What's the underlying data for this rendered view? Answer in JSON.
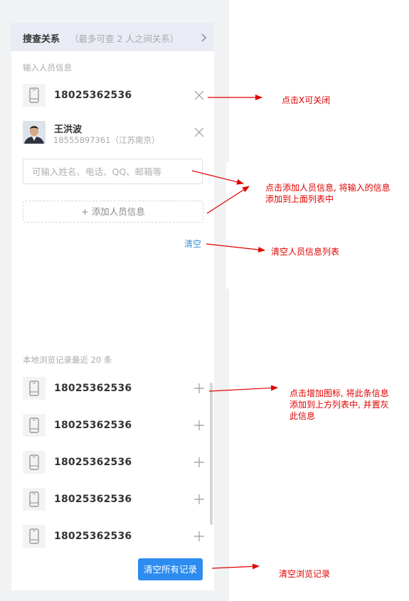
{
  "header": {
    "title": "搜查关系",
    "subtitle": "（最多可查 2 人之间关系）",
    "icon": "chevron-right-icon"
  },
  "input_section": {
    "label": "输入人员信息",
    "phone_entry": {
      "number": "18025362536",
      "icon": "mobile-phone-icon",
      "action_icon": "close-icon"
    },
    "person_entry": {
      "name": "王洪波",
      "detail": "18555897361（江苏南京）",
      "action_icon": "close-icon"
    },
    "search_input": {
      "value": "",
      "placeholder": "可输入姓名、电话、QQ、邮箱等"
    },
    "add_button_label": "+ 添加人员信息",
    "clear_label": "清空"
  },
  "history": {
    "label": "本地浏览记录最近 20 条",
    "items": [
      {
        "number": "18025362536"
      },
      {
        "number": "18025362536"
      },
      {
        "number": "18025362536"
      },
      {
        "number": "18025362536"
      },
      {
        "number": "18025362536"
      }
    ],
    "item_action_icon": "plus-icon",
    "clear_all_label": "清空所有记录"
  },
  "annotations": {
    "close": "点击X可关闭",
    "add_line1": "点击添加人员信息, 将输入的信息",
    "add_line2": "添加到上面列表中",
    "clear": "清空人员信息列表",
    "plus_line1": "点击增加图标, 将此条信息",
    "plus_line2": "添加到上方列表中, 并置灰",
    "plus_line3": "此信息",
    "clear_history": "清空浏览记录"
  },
  "colors": {
    "accent": "#2d8cf0",
    "link": "#3a8fd1",
    "annotation": "#e00000",
    "header_bg": "#e9ebf5"
  }
}
